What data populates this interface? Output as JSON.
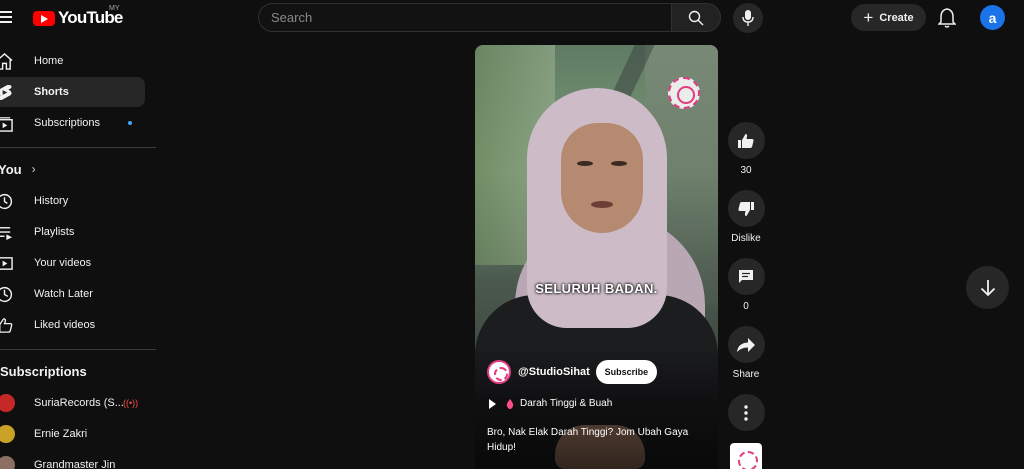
{
  "header": {
    "logo_text": "YouTube",
    "country_code": "MY",
    "search_placeholder": "Search",
    "create_label": "Create",
    "avatar_letter": "a"
  },
  "sidebar": {
    "main": [
      {
        "label": "Home",
        "icon": "home-icon"
      },
      {
        "label": "Shorts",
        "icon": "shorts-icon",
        "active": true
      },
      {
        "label": "Subscriptions",
        "icon": "subscriptions-icon",
        "has_new": true
      }
    ],
    "you_heading": "You",
    "you_chevron": "›",
    "you_items": [
      {
        "label": "History",
        "icon": "history-icon"
      },
      {
        "label": "Playlists",
        "icon": "playlists-icon"
      },
      {
        "label": "Your videos",
        "icon": "your-videos-icon"
      },
      {
        "label": "Watch Later",
        "icon": "watch-later-icon"
      },
      {
        "label": "Liked videos",
        "icon": "liked-videos-icon"
      }
    ],
    "subscriptions_heading": "Subscriptions",
    "subscriptions": [
      {
        "label": "SuriaRecords (S...",
        "live_indicator": "((•))",
        "avatar_color": "#c62828"
      },
      {
        "label": "Ernie Zakri",
        "avatar_color": "#c9a227"
      },
      {
        "label": "Grandmaster Jin",
        "avatar_color": "#8d6e63"
      }
    ]
  },
  "short": {
    "caption": "SELURUH BADAN.",
    "channel_handle": "@StudioSihat",
    "subscribe_label": "Subscribe",
    "music_label": "Darah Tinggi & Buah",
    "title": "Bro, Nak Elak Darah Tinggi? Jom Ubah Gaya Hidup!"
  },
  "actions": {
    "like_count": "30",
    "dislike_label": "Dislike",
    "comment_count": "0",
    "share_label": "Share"
  },
  "colors": {
    "background": "#0f0f0f",
    "surface": "#272727",
    "brand_red": "#ff0000",
    "accent_blue": "#3ea6ff",
    "avatar_blue": "#1a73e8",
    "studio_pink": "#e23d83"
  }
}
